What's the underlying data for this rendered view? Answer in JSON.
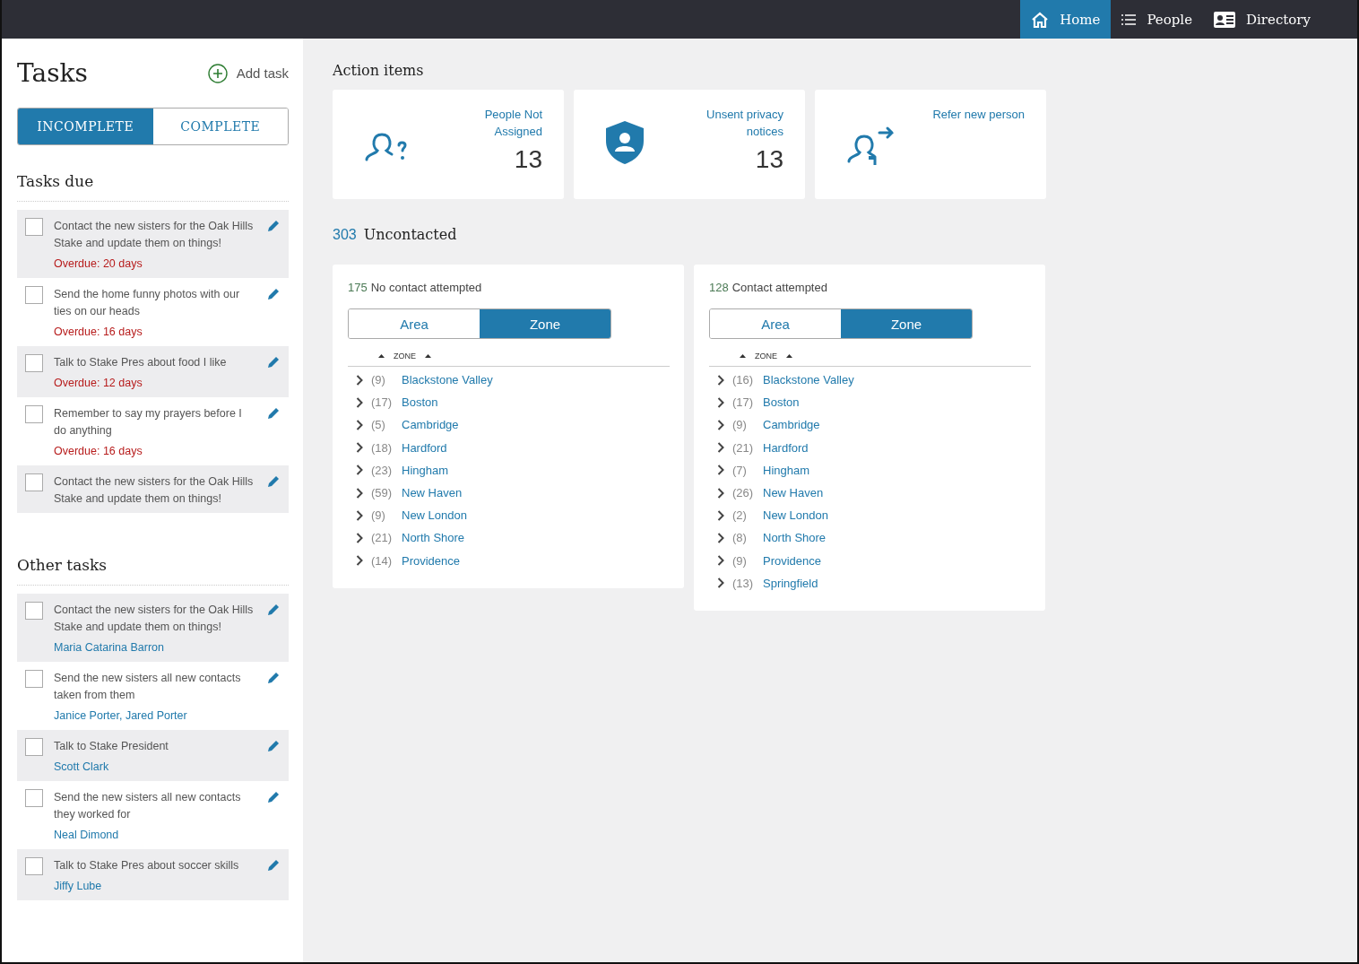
{
  "nav": {
    "items": [
      {
        "label": "Home",
        "kind": "home",
        "selected": true
      },
      {
        "label": "People",
        "kind": "list",
        "selected": false
      },
      {
        "label": "Directory",
        "kind": "card",
        "selected": false
      }
    ]
  },
  "tasks": {
    "title": "Tasks",
    "add_label": "Add task",
    "filter": [
      {
        "label": "INCOMPLETE",
        "selected": true
      },
      {
        "label": "COMPLETE",
        "selected": false
      }
    ],
    "sections": [
      {
        "title": "Tasks due",
        "items": [
          {
            "text": "Contact the new sisters for the Oak Hills Stake and update them on things!",
            "checked": false,
            "kind": "overdue",
            "note": "Overdue: 20 days"
          },
          {
            "text": "Send the home funny photos with our ties on our heads",
            "checked": false,
            "kind": "overdue",
            "note": "Overdue: 16 days"
          },
          {
            "text": "Talk to Stake Pres about food I like",
            "checked": false,
            "kind": "overdue",
            "note": "Overdue: 12 days"
          },
          {
            "text": "Remember to say my prayers before I do anything",
            "checked": false,
            "kind": "overdue",
            "note": "Overdue: 16 days"
          },
          {
            "text": "Contact the new sisters for the Oak Hills Stake and update them on things!",
            "checked": false,
            "kind": "plain"
          }
        ]
      },
      {
        "title": "Other tasks",
        "items": [
          {
            "text": "Contact the new sisters for the Oak Hills Stake and update them on things!",
            "checked": false,
            "kind": "person",
            "note": "Maria Catarina Barron"
          },
          {
            "text": "Send the new sisters all new contacts taken from them",
            "checked": false,
            "kind": "person",
            "note": "Janice Porter, Jared Porter"
          },
          {
            "text": "Talk to Stake President",
            "checked": false,
            "kind": "person",
            "note": "Scott Clark"
          },
          {
            "text": "Send the new sisters all new contacts they worked for",
            "checked": false,
            "kind": "person",
            "note": "Neal Dimond"
          },
          {
            "text": "Talk to Stake Pres about soccer skills",
            "checked": false,
            "kind": "person",
            "note": "Jiffy Lube"
          }
        ]
      }
    ]
  },
  "action_items": {
    "title": "Action items",
    "cards": [
      {
        "kind": "unassigned",
        "label": "People Not Assigned",
        "count": "13"
      },
      {
        "kind": "privacy",
        "label": "Unsent privacy notices",
        "count": "13"
      },
      {
        "kind": "refer",
        "label": "Refer new person"
      }
    ]
  },
  "uncontacted": {
    "count": "303",
    "title": "Uncontacted",
    "panels": [
      {
        "count": "175",
        "title": "No contact attempted",
        "toggle": [
          {
            "label": "Area",
            "selected": false
          },
          {
            "label": "Zone",
            "selected": true
          }
        ],
        "column": "ZONE",
        "rows": [
          {
            "count": "(9)",
            "name": "Blackstone Valley"
          },
          {
            "count": "(17)",
            "name": "Boston"
          },
          {
            "count": "(5)",
            "name": "Cambridge"
          },
          {
            "count": "(18)",
            "name": "Hardford"
          },
          {
            "count": "(23)",
            "name": "Hingham"
          },
          {
            "count": "(59)",
            "name": "New Haven"
          },
          {
            "count": "(9)",
            "name": "New London"
          },
          {
            "count": "(21)",
            "name": "North Shore"
          },
          {
            "count": "(14)",
            "name": "Providence"
          }
        ]
      },
      {
        "count": "128",
        "title": "Contact attempted",
        "toggle": [
          {
            "label": "Area",
            "selected": false
          },
          {
            "label": "Zone",
            "selected": true
          }
        ],
        "column": "ZONE",
        "rows": [
          {
            "count": "(16)",
            "name": "Blackstone Valley"
          },
          {
            "count": "(17)",
            "name": "Boston"
          },
          {
            "count": "(9)",
            "name": "Cambridge"
          },
          {
            "count": "(21)",
            "name": "Hardford"
          },
          {
            "count": "(7)",
            "name": "Hingham"
          },
          {
            "count": "(26)",
            "name": "New Haven"
          },
          {
            "count": "(2)",
            "name": "New London"
          },
          {
            "count": "(8)",
            "name": "North Shore"
          },
          {
            "count": "(9)",
            "name": "Providence"
          },
          {
            "count": "(13)",
            "name": "Springfield"
          }
        ]
      }
    ]
  }
}
